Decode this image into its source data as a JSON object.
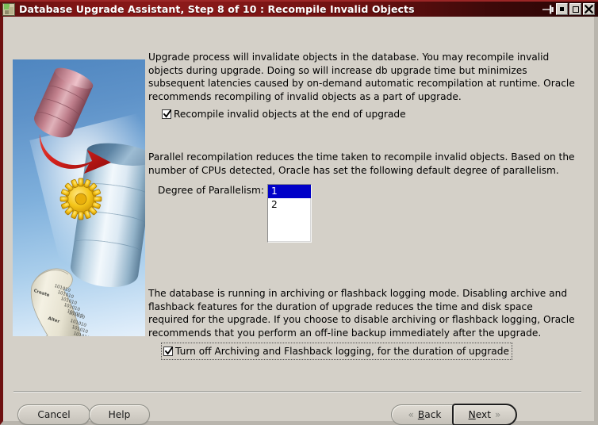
{
  "window": {
    "title": "Database Upgrade Assistant, Step 8 of 10 : Recompile Invalid Objects",
    "icon": "database-upgrade-assistant-icon",
    "controls": [
      {
        "name": "pin-window-button",
        "glyph": "pin"
      },
      {
        "name": "minimize-button",
        "glyph": "square-filled"
      },
      {
        "name": "maximize-button",
        "glyph": "square-outline"
      },
      {
        "name": "close-button",
        "glyph": "✖"
      }
    ],
    "titlebar_color": "#7e1414",
    "frame_color": "#d4d0c8"
  },
  "illustration": {
    "name": "database-upgrade-illustration",
    "background_color": "#5f93c9",
    "scroll_labels": [
      "Create",
      "Alter"
    ],
    "scroll_digits": [
      "101010",
      "101010",
      "101010",
      "101010",
      "101010",
      "101010",
      "101010",
      "101010",
      "101010",
      "101010",
      "101010"
    ]
  },
  "main": {
    "paragraph_1": "Upgrade process will invalidate objects in the database.  You may recompile invalid objects during upgrade.  Doing so will increase db upgrade time but minimizes subsequent latencies caused by on-demand automatic recompilation at runtime. Oracle recommends recompiling of invalid objects as a part of upgrade.",
    "checkbox_recompile": {
      "label": "Recompile invalid objects at the end of upgrade",
      "checked": true
    },
    "paragraph_2": "Parallel recompilation reduces the time taken to recompile invalid objects. Based on the number of CPUs detected, Oracle has set the following default degree of parallelism.",
    "parallelism": {
      "label": "Degree of Parallelism:",
      "options": [
        "1",
        "2"
      ],
      "selected": "1",
      "selected_index": 0,
      "selection_color": "#0000c8"
    },
    "paragraph_3": "The database is running in archiving or flashback logging mode. Disabling archive and flashback features for the duration of upgrade reduces the time and disk space required for the upgrade. If you choose to disable archiving or flashback logging, Oracle recommends that you perform an off-line backup immediately after the upgrade.",
    "checkbox_archiving": {
      "label": "Turn off Archiving and Flashback logging, for the duration of upgrade",
      "checked": true,
      "focused": true
    }
  },
  "footer": {
    "cancel_label": "Cancel",
    "help_label": "Help",
    "back": {
      "label_prefix": "",
      "mnemonic": "B",
      "label_rest": "ack",
      "chevron": "«"
    },
    "next": {
      "mnemonic": "N",
      "label_rest": "ext",
      "chevron": "»"
    },
    "default_button": "Next"
  }
}
